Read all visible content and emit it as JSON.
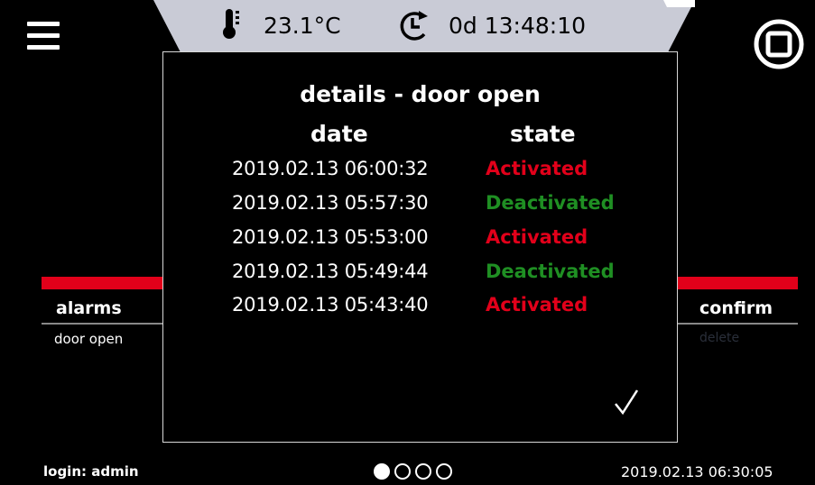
{
  "status": {
    "temperature": "23.1°C",
    "runtime": "0d 13:48:10",
    "temperature_icon": "thermometer-icon",
    "runtime_icon": "clock-icon"
  },
  "panels": {
    "left_title": "alarms",
    "left_item": "door open",
    "right_title": "confirm",
    "right_item": "delete"
  },
  "dialog": {
    "title": "details - door open",
    "col_date": "date",
    "col_state": "state",
    "rows": [
      {
        "date": "2019.02.13  06:00:32",
        "state": "Activated",
        "kind": "activated"
      },
      {
        "date": "2019.02.13  05:57:30",
        "state": "Deactivated",
        "kind": "deactivated"
      },
      {
        "date": "2019.02.13  05:53:00",
        "state": "Activated",
        "kind": "activated"
      },
      {
        "date": "2019.02.13  05:49:44",
        "state": "Deactivated",
        "kind": "deactivated"
      },
      {
        "date": "2019.02.13  05:43:40",
        "state": "Activated",
        "kind": "activated"
      }
    ],
    "confirm_icon": "check-icon"
  },
  "footer": {
    "login": "login: admin",
    "datetime": "2019.02.13 06:30:05",
    "pages": 4,
    "active_page": 1
  },
  "colors": {
    "accent_red": "#e2001a",
    "deactivated_green": "#1f8f23",
    "status_bar": "#c9cbd6"
  },
  "icons": {
    "menu": "menu-icon",
    "stop": "stop-icon"
  }
}
